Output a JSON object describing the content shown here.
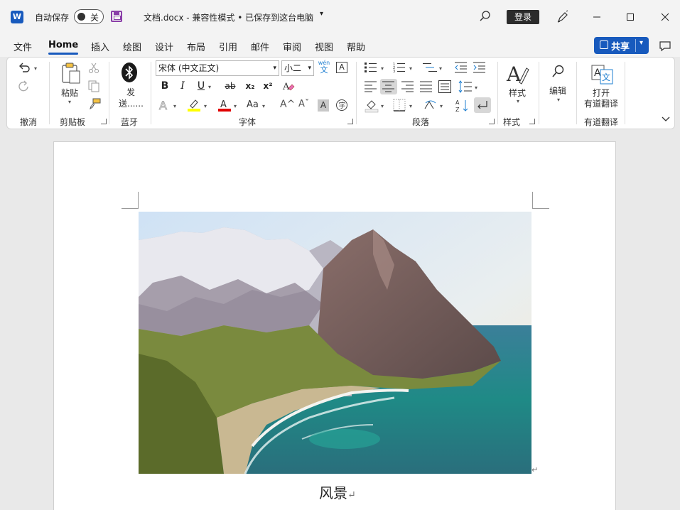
{
  "titlebar": {
    "app_logo": "W",
    "autosave_label": "自动保存",
    "autosave_state": "关",
    "doc_title": "文档.docx  -  兼容性模式 • 已保存到这台电脑",
    "login_label": "登录"
  },
  "menu": {
    "tabs": [
      "文件",
      "Home",
      "插入",
      "绘图",
      "设计",
      "布局",
      "引用",
      "邮件",
      "审阅",
      "视图",
      "帮助"
    ],
    "active_tab": "Home",
    "share_label": "共享"
  },
  "ribbon": {
    "groups": {
      "undo": "撤消",
      "clipboard": "剪贴板",
      "bluetooth": "蓝牙",
      "font": "字体",
      "paragraph": "段落",
      "styles": "样式",
      "youdao": "有道翻译"
    },
    "paste_label": "粘贴",
    "send_label_1": "发",
    "send_label_2": "送......",
    "font_name": "宋体 (中文正文)",
    "font_size": "小二",
    "phonetic_top": "wén",
    "phonetic_bottom": "文",
    "bold": "B",
    "italic": "I",
    "underline": "U",
    "strike": "ab",
    "subscript": "x₂",
    "superscript": "x²",
    "case_label": "Aa",
    "grow_font": "A^",
    "shrink_font": "Aˇ",
    "styles_label": "样式",
    "edit_label": "编辑",
    "youdao_open": "打开",
    "youdao_name": "有道翻译"
  },
  "document": {
    "caption": "风景",
    "pilcrow": "↵"
  },
  "colors": {
    "accent": "#185abd",
    "highlight": "#ffff00",
    "font_color": "#e00000"
  }
}
